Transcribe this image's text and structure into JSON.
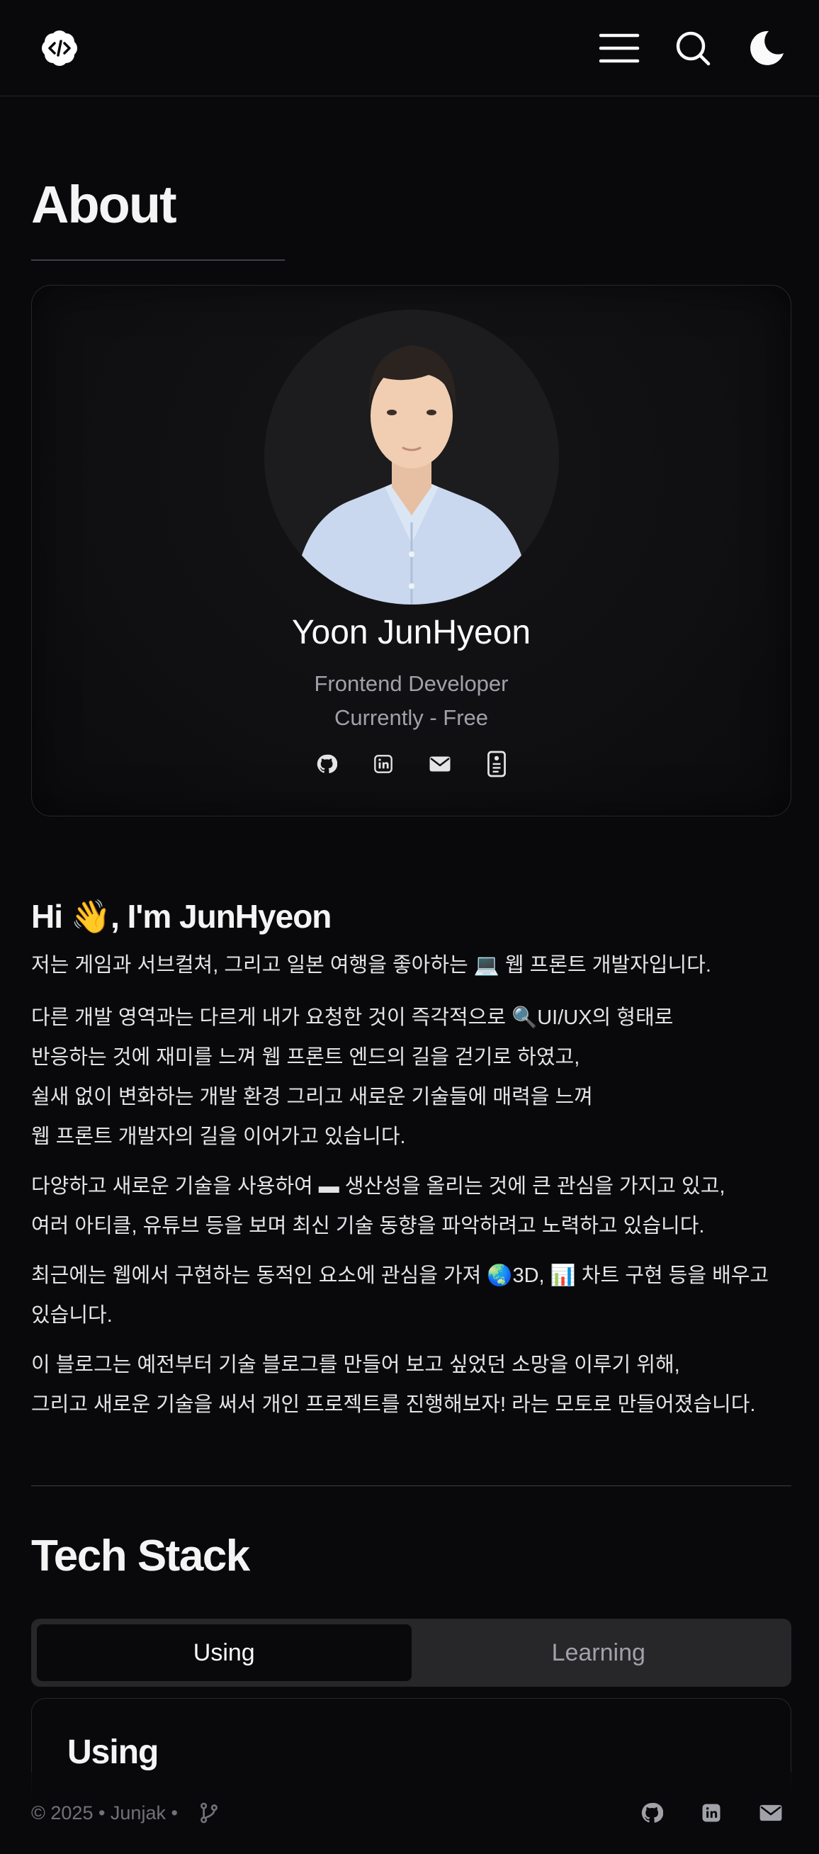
{
  "header": {
    "logo_icon": "code-flower-logo",
    "menu_icon": "hamburger-icon",
    "search_icon": "search-icon",
    "theme_icon": "moon-icon"
  },
  "about": {
    "title": "About"
  },
  "profile": {
    "name": "Yoon JunHyeon",
    "role": "Frontend Developer",
    "status": "Currently - Free",
    "socials": [
      "github-icon",
      "linkedin-icon",
      "mail-icon",
      "resume-icon"
    ]
  },
  "intro": {
    "heading_prefix": "Hi ",
    "heading_emoji": "👋",
    "heading_suffix": ", I'm JunHyeon",
    "paragraphs": [
      [
        "저는 게임과 서브컬쳐, 그리고 일본 여행을 좋아하는 💻 웹 프론트 개발자입니다."
      ],
      [
        "다른 개발 영역과는 다르게 내가 요청한 것이 즉각적으로 🔍UI/UX의 형태로",
        "반응하는 것에 재미를 느껴 웹 프론트 엔드의 길을 걷기로 하였고,",
        "쉴새 없이 변화하는 개발 환경 그리고 새로운 기술들에 매력을 느껴",
        "웹 프론트 개발자의 길을 이어가고 있습니다."
      ],
      [
        "다양하고 새로운 기술을 사용하여 ▬ 생산성을 올리는 것에 큰 관심을 가지고 있고,",
        "여러 아티클, 유튜브 등을 보며 최신 기술 동향을 파악하려고 노력하고 있습니다."
      ],
      [
        "최근에는 웹에서 구현하는 동적인 요소에 관심을 가져 🌏3D, 📊 차트 구현 등을 배우고",
        "있습니다."
      ],
      [
        "이 블로그는 예전부터 기술 블로그를 만들어 보고 싶었던 소망을 이루기 위해,",
        "그리고 새로운 기술을 써서 개인 프로젝트를 진행해보자! 라는 모토로 만들어졌습니다."
      ]
    ]
  },
  "tech": {
    "title": "Tech Stack",
    "tabs": [
      "Using",
      "Learning"
    ],
    "active_tab": "Using",
    "panel_title": "Using"
  },
  "footer": {
    "copyright": "© 2025 • Junjak •",
    "branch_icon": "git-branch-icon",
    "socials": [
      "github-icon",
      "linkedin-icon",
      "mail-icon"
    ]
  },
  "colors": {
    "background": "#09090b",
    "text": "#f4f4f5",
    "muted": "#a1a1aa",
    "border": "#27272a"
  }
}
